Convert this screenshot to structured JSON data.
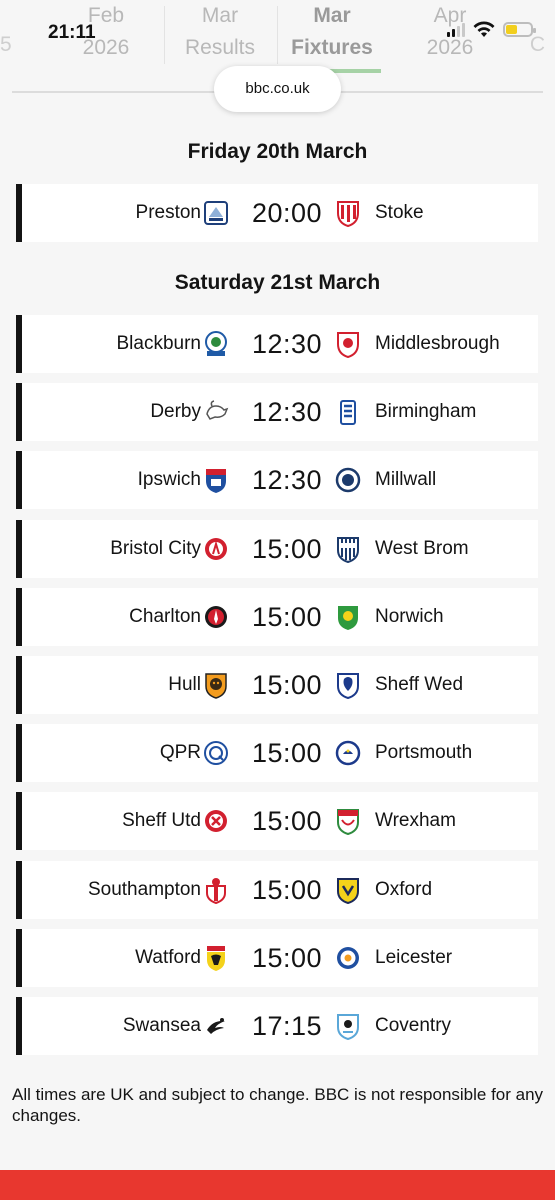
{
  "status_bar": {
    "time": "21:11"
  },
  "tabs": [
    {
      "month": "Feb",
      "year": "2026",
      "active": false
    },
    {
      "month": "Mar",
      "year": "Results",
      "active": false
    },
    {
      "month": "Mar",
      "year": "Fixtures",
      "active": true
    },
    {
      "month": "Apr",
      "year": "2026",
      "active": false
    }
  ],
  "tab_edges": {
    "left": "5",
    "right": "C"
  },
  "browser": {
    "url": "bbc.co.uk"
  },
  "days": [
    {
      "heading": "Friday 20th March",
      "fixtures": [
        {
          "home": "Preston",
          "time": "20:00",
          "away": "Stoke",
          "home_crest": "preston-crest-icon",
          "away_crest": "stoke-crest-icon"
        }
      ]
    },
    {
      "heading": "Saturday 21st March",
      "fixtures": [
        {
          "home": "Blackburn",
          "time": "12:30",
          "away": "Middlesbrough",
          "home_crest": "blackburn-crest-icon",
          "away_crest": "middlesbrough-crest-icon"
        },
        {
          "home": "Derby",
          "time": "12:30",
          "away": "Birmingham",
          "home_crest": "derby-crest-icon",
          "away_crest": "birmingham-crest-icon"
        },
        {
          "home": "Ipswich",
          "time": "12:30",
          "away": "Millwall",
          "home_crest": "ipswich-crest-icon",
          "away_crest": "millwall-crest-icon"
        },
        {
          "home": "Bristol City",
          "time": "15:00",
          "away": "West Brom",
          "home_crest": "bristol-city-crest-icon",
          "away_crest": "west-brom-crest-icon"
        },
        {
          "home": "Charlton",
          "time": "15:00",
          "away": "Norwich",
          "home_crest": "charlton-crest-icon",
          "away_crest": "norwich-crest-icon"
        },
        {
          "home": "Hull",
          "time": "15:00",
          "away": "Sheff Wed",
          "home_crest": "hull-crest-icon",
          "away_crest": "sheff-wed-crest-icon"
        },
        {
          "home": "QPR",
          "time": "15:00",
          "away": "Portsmouth",
          "home_crest": "qpr-crest-icon",
          "away_crest": "portsmouth-crest-icon"
        },
        {
          "home": "Sheff Utd",
          "time": "15:00",
          "away": "Wrexham",
          "home_crest": "sheff-utd-crest-icon",
          "away_crest": "wrexham-crest-icon"
        },
        {
          "home": "Southampton",
          "time": "15:00",
          "away": "Oxford",
          "home_crest": "southampton-crest-icon",
          "away_crest": "oxford-crest-icon"
        },
        {
          "home": "Watford",
          "time": "15:00",
          "away": "Leicester",
          "home_crest": "watford-crest-icon",
          "away_crest": "leicester-crest-icon"
        },
        {
          "home": "Swansea",
          "time": "17:15",
          "away": "Coventry",
          "home_crest": "swansea-crest-icon",
          "away_crest": "coventry-crest-icon"
        }
      ]
    }
  ],
  "footer_note": "All times are UK and subject to change. BBC is not responsible for any changes.",
  "colors": {
    "accent_bar": "#e8372f",
    "row_marker": "#141414",
    "tab_underline": "#a6d2a6"
  }
}
